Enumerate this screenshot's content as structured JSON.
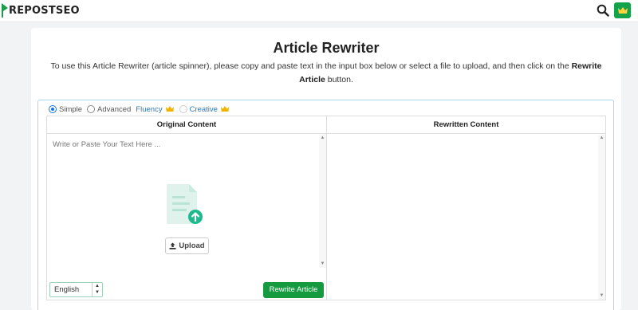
{
  "header": {
    "logo_text": "REPOSTSEO",
    "search_icon": "search-icon",
    "premium_icon": "crown-icon",
    "accent": "#14a34a"
  },
  "page": {
    "title": "Article Rewriter",
    "description_prefix": "To use this Article Rewriter (article spinner), please copy and paste text in the input box below or select a file to upload, and then click on the ",
    "description_bold": "Rewrite Article",
    "description_suffix": " button."
  },
  "modes": {
    "simple": "Simple",
    "advanced": "Advanced",
    "fluency": "Fluency",
    "creative": "Creative",
    "selected": "Simple"
  },
  "original": {
    "header": "Original Content",
    "placeholder": "Write or Paste Your Text Here ...",
    "upload_label": "Upload"
  },
  "rewritten": {
    "header": "Rewritten Content"
  },
  "footer": {
    "language": "English",
    "rewrite_button": "Rewrite Article",
    "button_color": "#159a3f"
  }
}
